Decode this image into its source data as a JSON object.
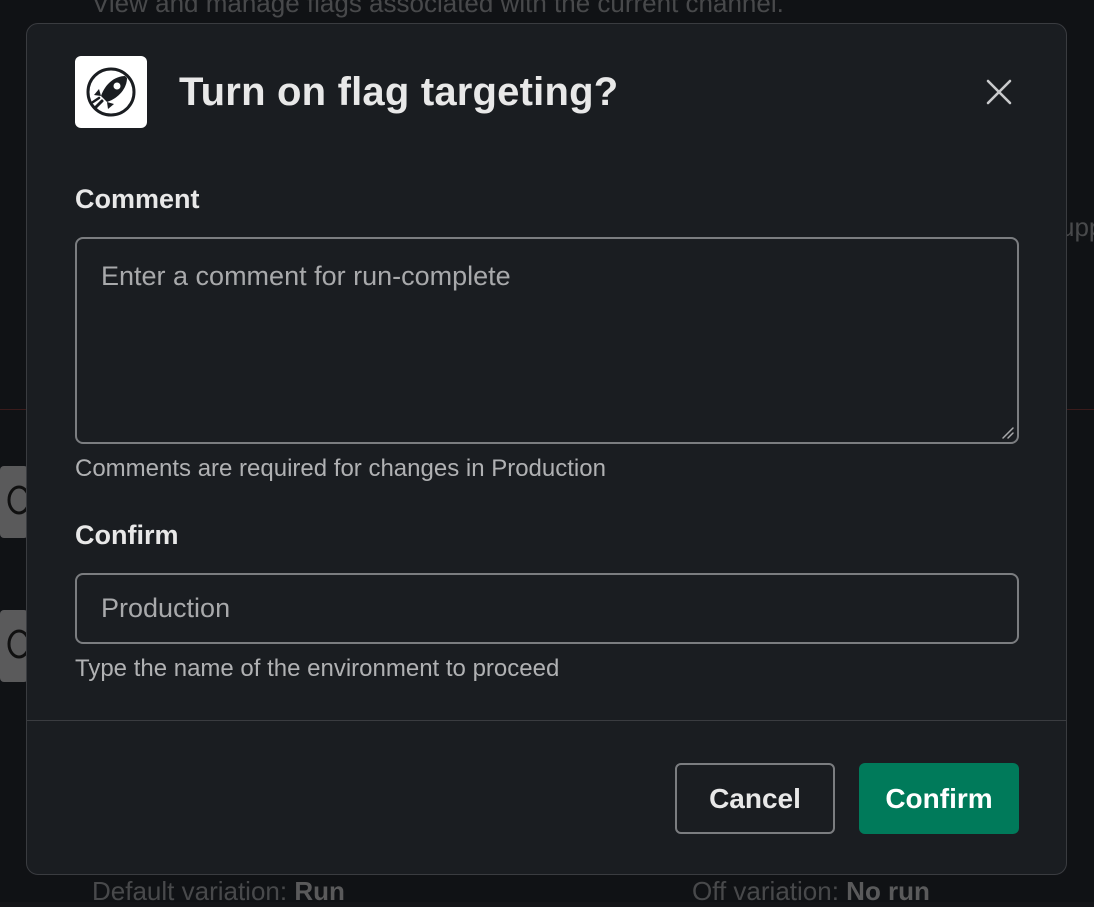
{
  "background": {
    "top_text": "View and manage flags associated with the current channel.",
    "right_text": "upp",
    "bottom_left_label": "Default variation:",
    "bottom_left_value": "Run",
    "bottom_right_label": "Off variation:",
    "bottom_right_value": "No run"
  },
  "modal": {
    "app_icon": "rocket-icon",
    "title": "Turn on flag targeting?",
    "close_icon": "close-icon",
    "comment": {
      "label": "Comment",
      "value": "",
      "placeholder": "Enter a comment for run-complete",
      "hint": "Comments are required for changes in Production"
    },
    "confirm_field": {
      "label": "Confirm",
      "value": "",
      "placeholder": "Production",
      "hint": "Type the name of the environment to proceed"
    },
    "buttons": {
      "cancel": "Cancel",
      "confirm": "Confirm"
    }
  },
  "colors": {
    "modal_bg": "#1a1d21",
    "primary": "#007a5a",
    "border": "#7b7d80"
  }
}
